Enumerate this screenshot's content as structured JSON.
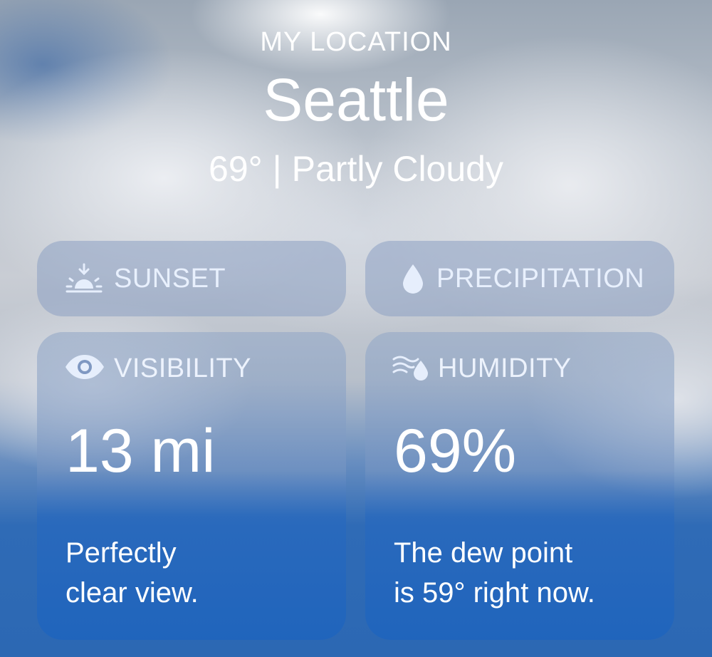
{
  "header": {
    "location_label": "MY LOCATION",
    "city": "Seattle",
    "temperature": "69°",
    "separator": "|",
    "condition": "Partly Cloudy"
  },
  "tiles": {
    "sunset": {
      "label": "SUNSET",
      "icon": "sunset-icon"
    },
    "precipitation": {
      "label": "PRECIPITATION",
      "icon": "raindrop-icon"
    },
    "visibility": {
      "label": "VISIBILITY",
      "icon": "eye-icon",
      "value": "13 mi",
      "description_line1": "Perfectly",
      "description_line2": "clear view."
    },
    "humidity": {
      "label": "HUMIDITY",
      "icon": "humidity-icon",
      "value": "69%",
      "description_line1": "The dew point",
      "description_line2": "is 59° right now."
    }
  },
  "colors": {
    "label_text": "#ebf2ff",
    "card_blue": "#1e64be"
  }
}
